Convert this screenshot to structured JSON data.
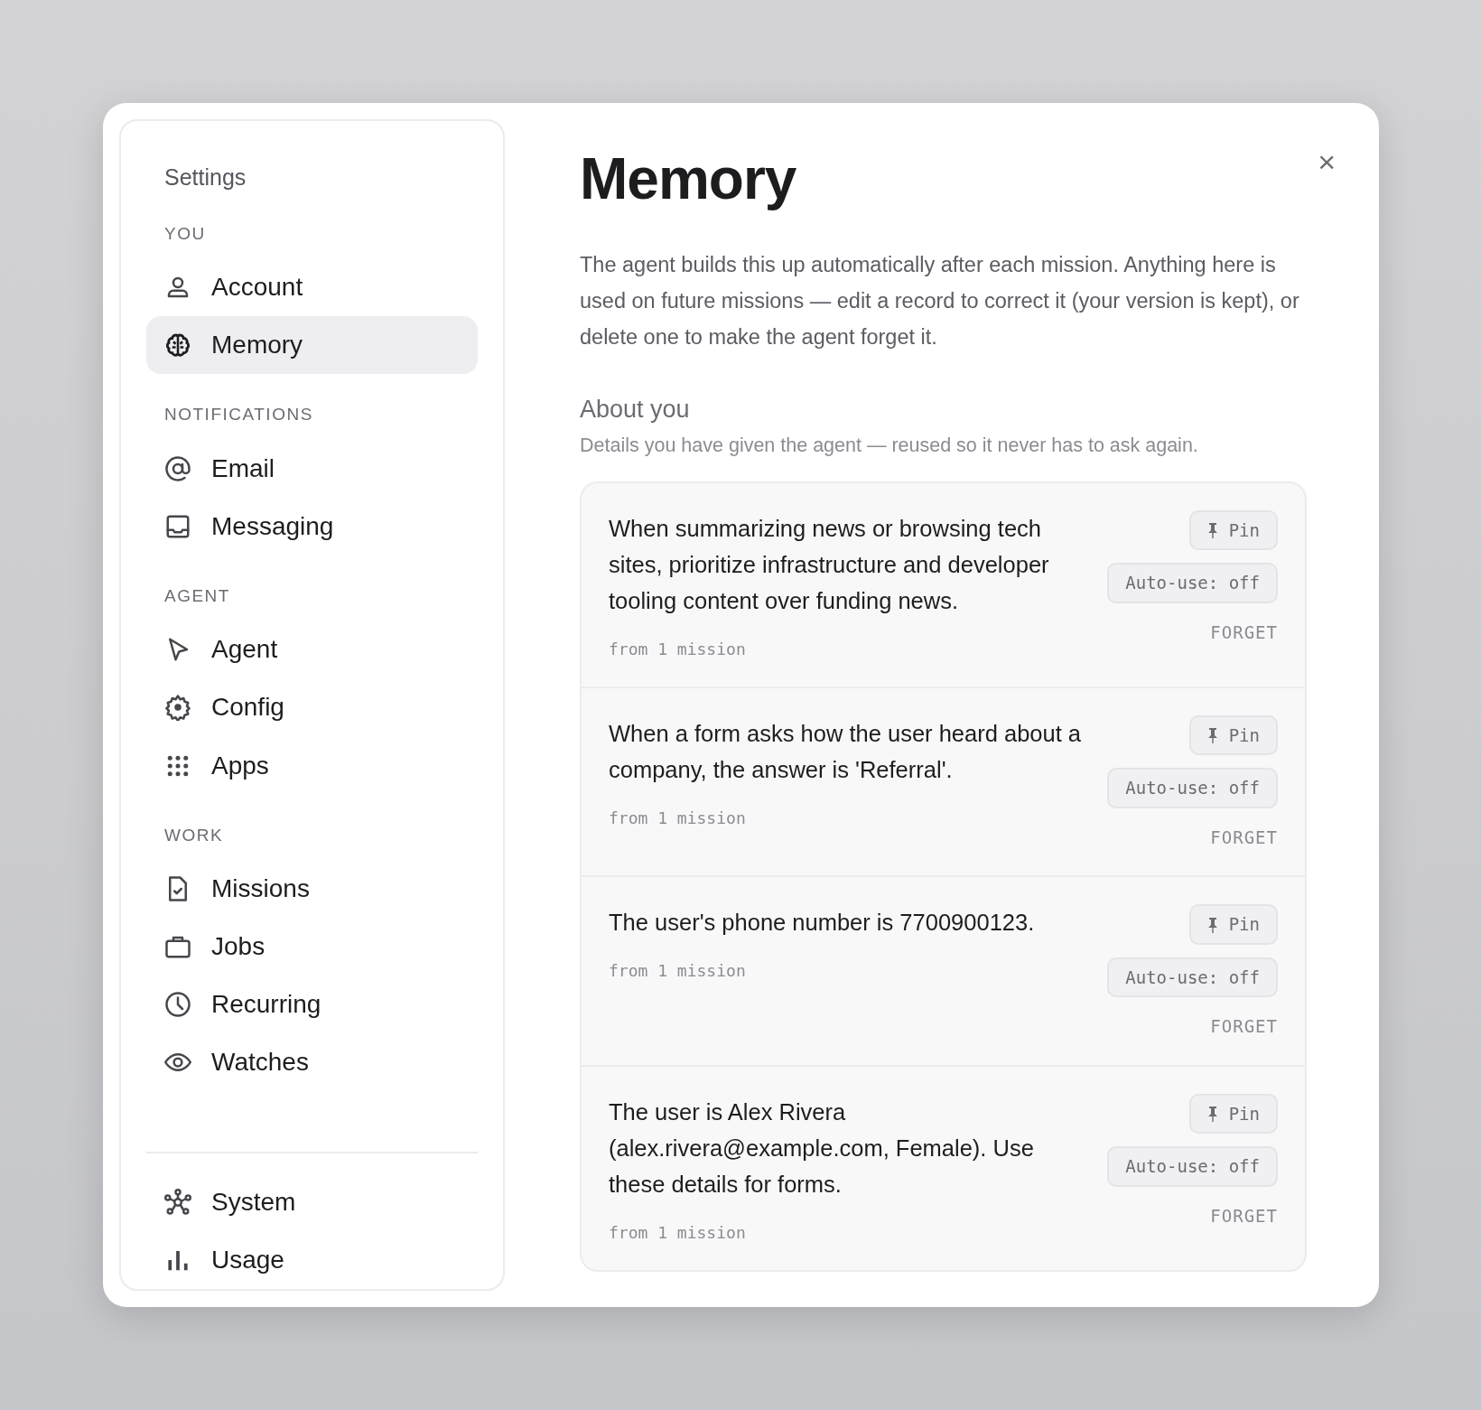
{
  "dialog": {
    "close": "×"
  },
  "sidebar": {
    "title": "Settings",
    "sections": [
      {
        "heading": "YOU",
        "items": [
          {
            "kind": "person",
            "label": "Account",
            "selected": false
          },
          {
            "kind": "brain",
            "label": "Memory",
            "selected": true
          }
        ]
      },
      {
        "heading": "NOTIFICATIONS",
        "items": [
          {
            "kind": "at",
            "label": "Email",
            "selected": false
          },
          {
            "kind": "inbox",
            "label": "Messaging",
            "selected": false
          }
        ]
      },
      {
        "heading": "AGENT",
        "items": [
          {
            "kind": "pointer",
            "label": "Agent",
            "selected": false
          },
          {
            "kind": "gear",
            "label": "Config",
            "selected": false
          },
          {
            "kind": "grid",
            "label": "Apps",
            "selected": false
          }
        ]
      },
      {
        "heading": "WORK",
        "items": [
          {
            "kind": "doc",
            "label": "Missions",
            "selected": false
          },
          {
            "kind": "briefcase",
            "label": "Jobs",
            "selected": false
          },
          {
            "kind": "clock",
            "label": "Recurring",
            "selected": false
          },
          {
            "kind": "eye",
            "label": "Watches",
            "selected": false
          }
        ]
      }
    ],
    "footer_items": [
      {
        "kind": "network",
        "label": "System",
        "selected": false
      },
      {
        "kind": "bars",
        "label": "Usage",
        "selected": false
      }
    ]
  },
  "main": {
    "title": "Memory",
    "description": "The agent builds this up automatically after each mission. Anything here is used on future missions — edit a record to correct it (your version is kept), or delete one to make the agent forget it.",
    "section": {
      "title": "About you",
      "subtitle": "Details you have given the agent — reused so it never has to ask again.",
      "records": [
        {
          "text": "When summarizing news or browsing tech sites, prioritize infrastructure and developer tooling content over funding news.",
          "source": "from 1 mission",
          "pin": "Pin",
          "auto_use": "Auto-use: off",
          "forget": "FORGET"
        },
        {
          "text": "When a form asks how the user heard about a company, the answer is 'Referral'.",
          "source": "from 1 mission",
          "pin": "Pin",
          "auto_use": "Auto-use: off",
          "forget": "FORGET"
        },
        {
          "text": "The user's phone number is 7700900123.",
          "source": "from 1 mission",
          "pin": "Pin",
          "auto_use": "Auto-use: off",
          "forget": "FORGET"
        },
        {
          "text": "The user is Alex Rivera (alex.rivera@example.com, Female). Use these details for forms.",
          "source": "from 1 mission",
          "pin": "Pin",
          "auto_use": "Auto-use: off",
          "forget": "FORGET"
        }
      ]
    }
  }
}
